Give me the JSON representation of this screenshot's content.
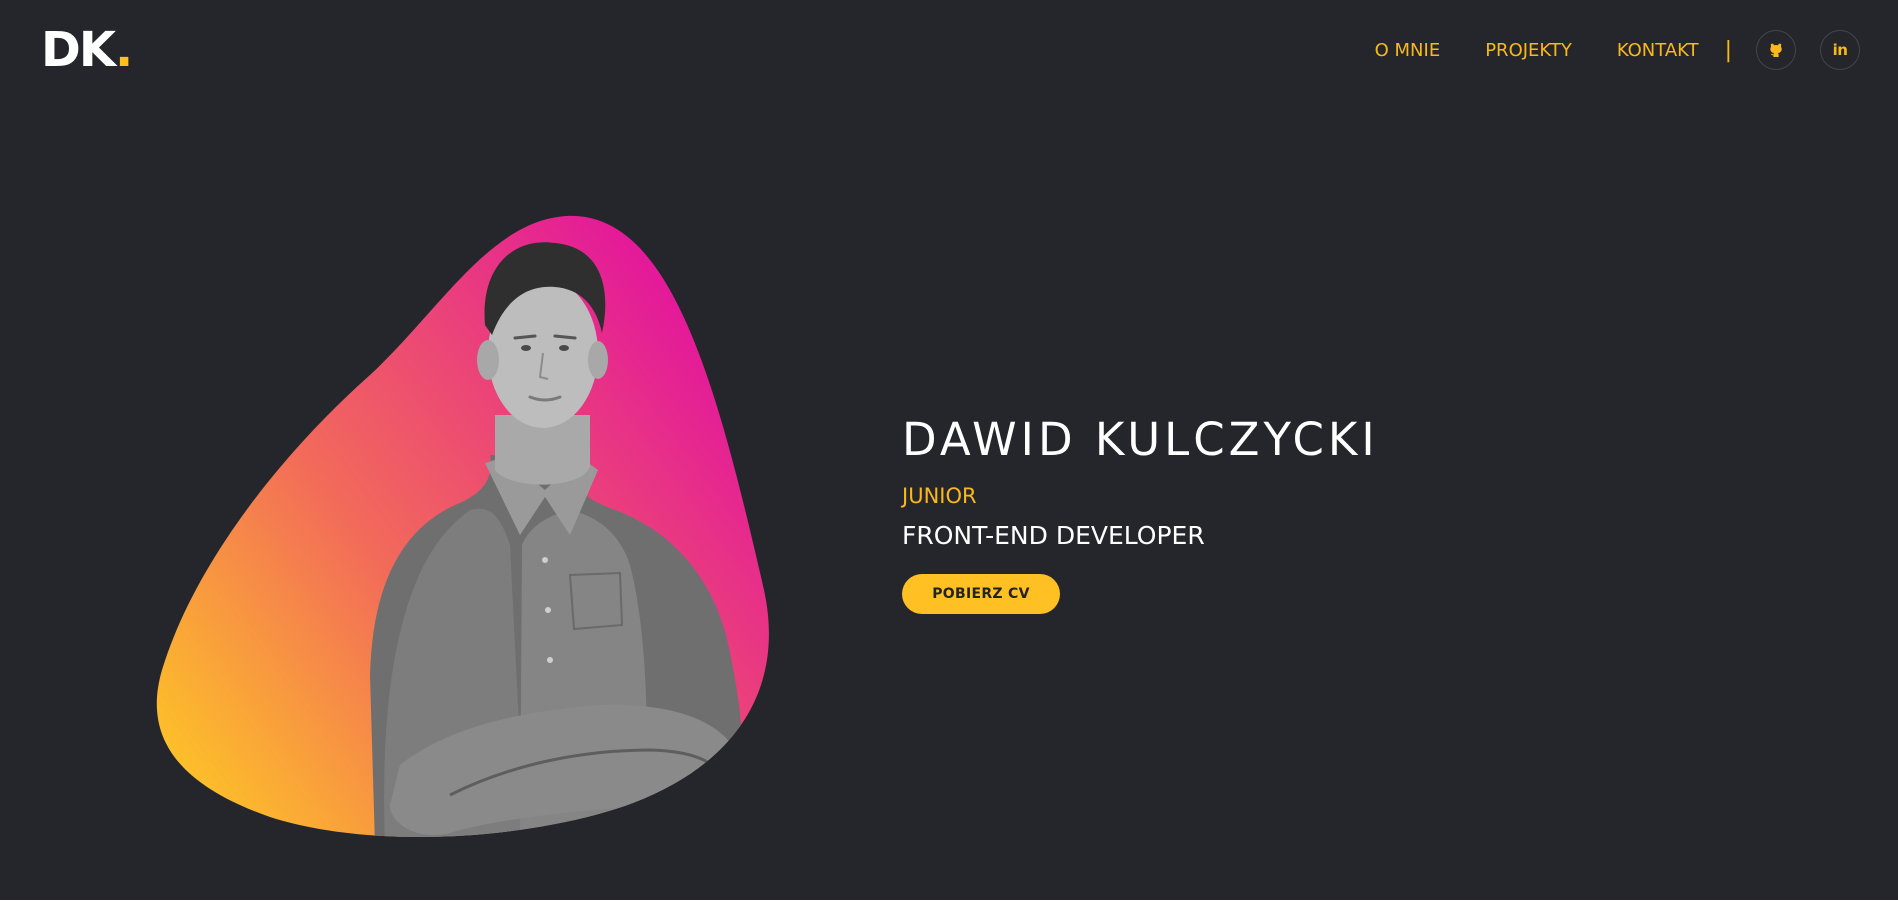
{
  "header": {
    "logo": {
      "text": "DK",
      "dot": "."
    },
    "nav": [
      {
        "label": "O MNIE"
      },
      {
        "label": "PROJEKTY"
      },
      {
        "label": "KONTAKT"
      }
    ],
    "separator": "|",
    "social": [
      {
        "icon": "github-icon"
      },
      {
        "icon": "linkedin-icon",
        "text": "in"
      }
    ]
  },
  "hero": {
    "name": "DAWID KULCZYCKI",
    "level": "JUNIOR",
    "role": "FRONT-END DEVELOPER",
    "cv_button": "POBIERZ CV",
    "photo": {
      "description": "grayscale portrait photo",
      "icon": "portrait-photo"
    }
  },
  "colors": {
    "background": "#25262b",
    "accent": "#f9b81c",
    "gradient_start": "#ffd11f",
    "gradient_mid": "#f26a5a",
    "gradient_end": "#e2139f"
  }
}
